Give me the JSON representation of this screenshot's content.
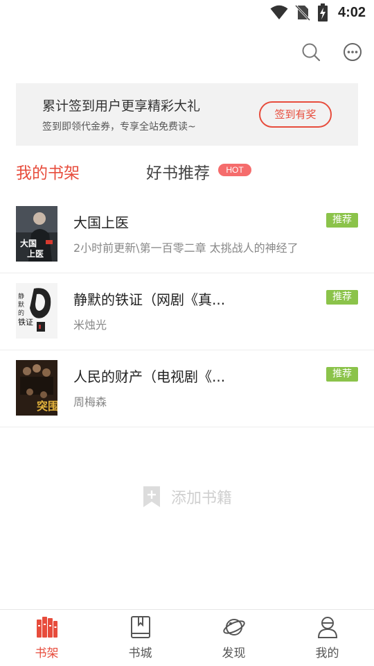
{
  "status_bar": {
    "time": "4:02"
  },
  "top_actions": {
    "search_icon": "search-icon",
    "more_icon": "more-icon"
  },
  "banner": {
    "title": "累计签到用户更享精彩大礼",
    "subtitle": "签到即领代金券，专享全站免费读~",
    "button_label": "签到有奖"
  },
  "tabs": {
    "shelf": "我的书架",
    "recommend": "好书推荐",
    "hot_badge": "HOT"
  },
  "books": [
    {
      "title": "大国上医",
      "subtitle": "2小时前更新\\第一百零二章 太挑战人的神经了",
      "badge": "推荐",
      "cover_text": "大国上医"
    },
    {
      "title": "静默的铁证（网剧《真...",
      "subtitle": "米烛光",
      "badge": "推荐",
      "cover_text": "静默的铁证"
    },
    {
      "title": "人民的财产（电视剧《...",
      "subtitle": "周梅森",
      "badge": "推荐",
      "cover_text": "突围"
    }
  ],
  "add_book": {
    "label": "添加书籍"
  },
  "bottom_nav": [
    {
      "label": "书架",
      "icon": "bookshelf-icon",
      "active": true
    },
    {
      "label": "书城",
      "icon": "bookstore-icon",
      "active": false
    },
    {
      "label": "发现",
      "icon": "discover-planet-icon",
      "active": false
    },
    {
      "label": "我的",
      "icon": "profile-icon",
      "active": false
    }
  ],
  "colors": {
    "accent": "#e74c3c",
    "badge_green": "#8bc34a",
    "hot": "#f56c6c"
  }
}
